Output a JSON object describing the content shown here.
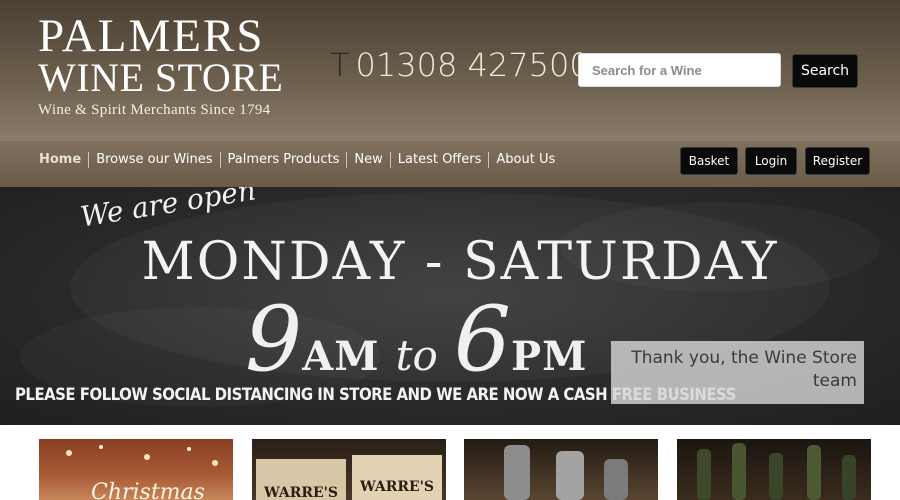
{
  "header": {
    "logo_line1": "PALMERS",
    "logo_line2": "WINE STORE",
    "logo_tagline": "Wine & Spirit Merchants Since 1794",
    "phone_prefix": "T",
    "phone_number": "01308 427500",
    "search_placeholder": "Search for a Wine",
    "search_button": "Search"
  },
  "nav": {
    "items": [
      {
        "label": "Home"
      },
      {
        "label": "Browse our Wines"
      },
      {
        "label": "Palmers Products"
      },
      {
        "label": "New"
      },
      {
        "label": "Latest Offers"
      },
      {
        "label": "About Us"
      }
    ],
    "basket": "Basket",
    "login": "Login",
    "register": "Register"
  },
  "banner": {
    "open_text": "We are open",
    "days": "MONDAY - SATURDAY",
    "open_hour": "9",
    "open_suffix": "AM",
    "to_word": "to",
    "close_hour": "6",
    "close_suffix": "PM",
    "notice": "PLEASE FOLLOW SOCIAL DISTANCING IN STORE AND WE ARE NOW A CASH FREE BUSINESS",
    "thanks": "Thank you, the Wine Store team"
  },
  "tiles": {
    "tile1_text": "Christmas",
    "tile2_label1": "WARRE'S",
    "tile2_label2": "WARRE'S"
  },
  "colors": {
    "header_top": "#4b4033",
    "header_bottom": "#8a7c68",
    "nav_bg": "#6a5c49",
    "button_bg": "#0a0a0a",
    "chalkboard": "#2a2a2a"
  }
}
